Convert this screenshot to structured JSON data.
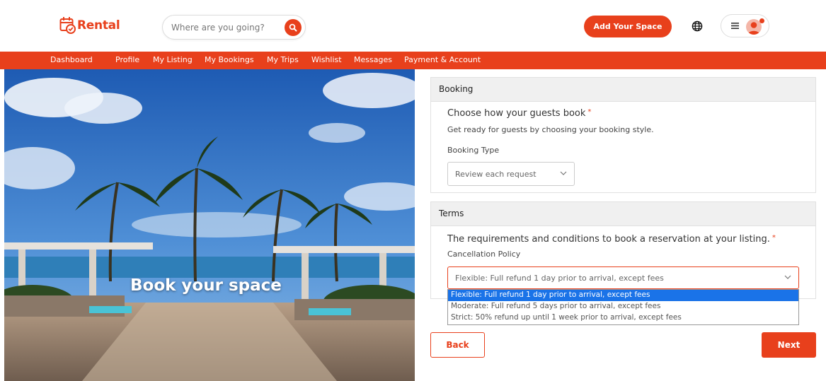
{
  "header": {
    "logo_text": "Rental",
    "search": {
      "placeholder": "Where are you going?"
    },
    "add_space_label": "Add Your Space"
  },
  "nav": {
    "items": [
      "Dashboard",
      "Profile",
      "My Listing",
      "My Bookings",
      "My Trips",
      "Wishlist",
      "Messages",
      "Payment & Account"
    ]
  },
  "hero": {
    "title": "Book your space"
  },
  "booking": {
    "section_title": "Booking",
    "question": "Choose how your guests book",
    "required_mark": "*",
    "subtitle": "Get ready for guests by choosing your booking style.",
    "type_label": "Booking Type",
    "type_value": "Review each request"
  },
  "terms": {
    "section_title": "Terms",
    "question": "The requirements and conditions to book a reservation at your listing.",
    "required_mark": "*",
    "policy_label": "Cancellation Policy",
    "policy_value": "Flexible: Full refund 1 day prior to arrival, except fees",
    "policy_options": [
      "Flexible: Full refund 1 day prior to arrival, except fees",
      "Moderate: Full refund 5 days prior to arrival, except fees",
      "Strict: 50% refund up until 1 week prior to arrival, except fees"
    ],
    "selected_option_index": 0
  },
  "actions": {
    "back_label": "Back",
    "next_label": "Next"
  },
  "colors": {
    "accent": "#e8401c",
    "selected_option": "#1a73e8",
    "panel_header": "#f0f0f0"
  }
}
